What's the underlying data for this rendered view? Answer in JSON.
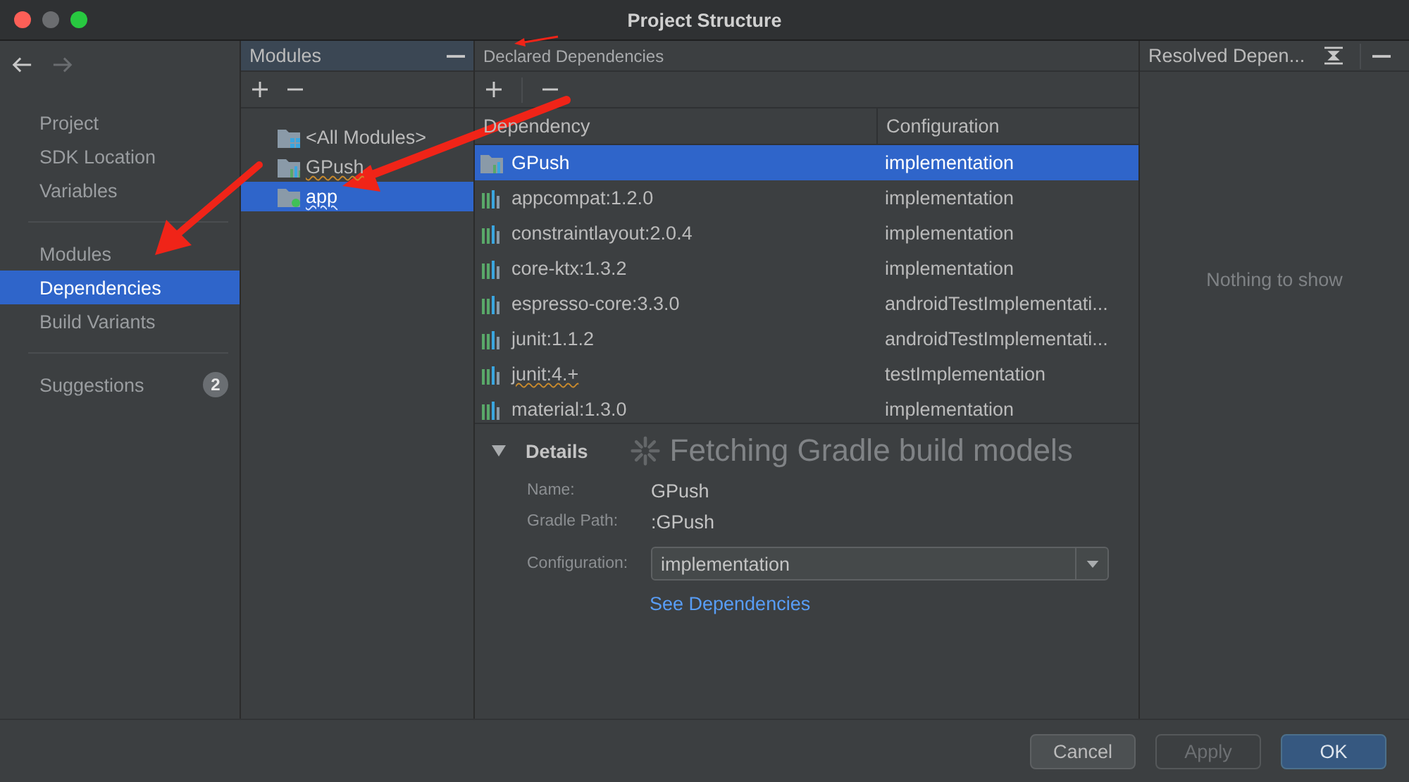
{
  "window": {
    "title": "Project Structure"
  },
  "sidebar": {
    "groups": [
      [
        {
          "label": "Project",
          "selected": false
        },
        {
          "label": "SDK Location",
          "selected": false
        },
        {
          "label": "Variables",
          "selected": false
        }
      ],
      [
        {
          "label": "Modules",
          "selected": false
        },
        {
          "label": "Dependencies",
          "selected": true
        },
        {
          "label": "Build Variants",
          "selected": false
        }
      ],
      [
        {
          "label": "Suggestions",
          "selected": false,
          "badge": "2"
        }
      ]
    ]
  },
  "modules": {
    "title": "Modules",
    "items": [
      {
        "label": "<All Modules>",
        "kind": "all",
        "selected": false,
        "flagged": false
      },
      {
        "label": "GPush",
        "kind": "library",
        "selected": false,
        "flagged": true
      },
      {
        "label": "app",
        "kind": "app",
        "selected": true,
        "flagged": true
      }
    ]
  },
  "declared": {
    "title": "Declared Dependencies",
    "columns": [
      "Dependency",
      "Configuration"
    ],
    "rows": [
      {
        "name": "GPush",
        "configuration": "implementation",
        "kind": "module",
        "selected": true,
        "flagged": false
      },
      {
        "name": "appcompat:1.2.0",
        "configuration": "implementation",
        "kind": "library",
        "selected": false,
        "flagged": false
      },
      {
        "name": "constraintlayout:2.0.4",
        "configuration": "implementation",
        "kind": "library",
        "selected": false,
        "flagged": false
      },
      {
        "name": "core-ktx:1.3.2",
        "configuration": "implementation",
        "kind": "library",
        "selected": false,
        "flagged": false
      },
      {
        "name": "espresso-core:3.3.0",
        "configuration": "androidTestImplementati...",
        "kind": "library",
        "selected": false,
        "flagged": false
      },
      {
        "name": "junit:1.1.2",
        "configuration": "androidTestImplementati...",
        "kind": "library",
        "selected": false,
        "flagged": false
      },
      {
        "name": "junit:4.+",
        "configuration": "testImplementation",
        "kind": "library",
        "selected": false,
        "flagged": true
      },
      {
        "name": "material:1.3.0",
        "configuration": "implementation",
        "kind": "library",
        "selected": false,
        "flagged": false
      }
    ],
    "loading_text": "Fetching Gradle build models",
    "details": {
      "title": "Details",
      "expanded": true,
      "fields": [
        {
          "label": "Name:",
          "value": "GPush"
        },
        {
          "label": "Gradle Path:",
          "value": ":GPush"
        }
      ],
      "configuration": {
        "label": "Configuration:",
        "value": "implementation"
      },
      "link": "See Dependencies"
    }
  },
  "resolved": {
    "title": "Resolved Depen...",
    "empty_text": "Nothing to show"
  },
  "buttons": [
    {
      "label": "Cancel",
      "kind": "normal"
    },
    {
      "label": "Apply",
      "kind": "disabled"
    },
    {
      "label": "OK",
      "kind": "default"
    }
  ]
}
